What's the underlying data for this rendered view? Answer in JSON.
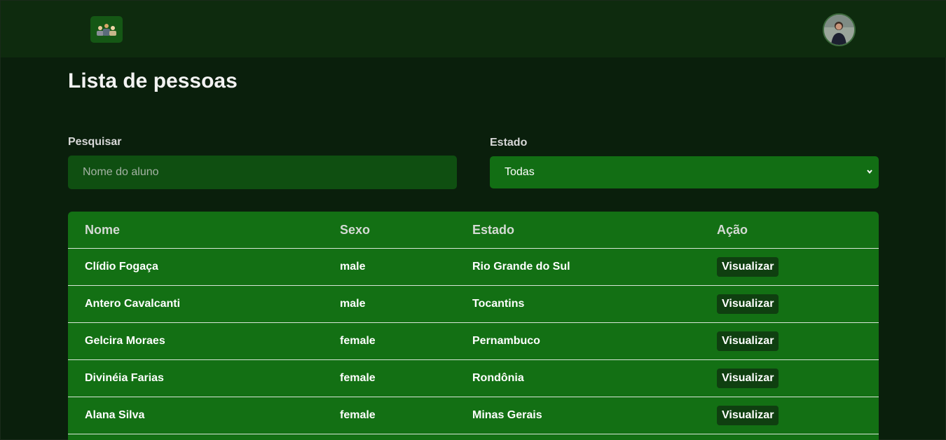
{
  "header": {
    "logo_icon": "people-group-icon",
    "avatar_icon": "user-avatar"
  },
  "page": {
    "title": "Lista de pessoas"
  },
  "filters": {
    "search_label": "Pesquisar",
    "search_placeholder": "Nome do aluno",
    "search_value": "",
    "state_label": "Estado",
    "state_selected": "Todas"
  },
  "table": {
    "headers": {
      "nome": "Nome",
      "sexo": "Sexo",
      "estado": "Estado",
      "acao": "Ação"
    },
    "rows": [
      {
        "nome": "Clídio Fogaça",
        "sexo": "male",
        "estado": "Rio Grande do Sul",
        "acao": "Visualizar"
      },
      {
        "nome": "Antero Cavalcanti",
        "sexo": "male",
        "estado": "Tocantins",
        "acao": "Visualizar"
      },
      {
        "nome": "Gelcira Moraes",
        "sexo": "female",
        "estado": "Pernambuco",
        "acao": "Visualizar"
      },
      {
        "nome": "Divinéia Farias",
        "sexo": "female",
        "estado": "Rondônia",
        "acao": "Visualizar"
      },
      {
        "nome": "Alana Silva",
        "sexo": "female",
        "estado": "Minas Gerais",
        "acao": "Visualizar"
      }
    ]
  },
  "colors": {
    "background": "#0a1f0c",
    "topbar": "#0e2b0e",
    "table": "#137014",
    "input": "#0f4f11",
    "button": "#0f3f10"
  }
}
